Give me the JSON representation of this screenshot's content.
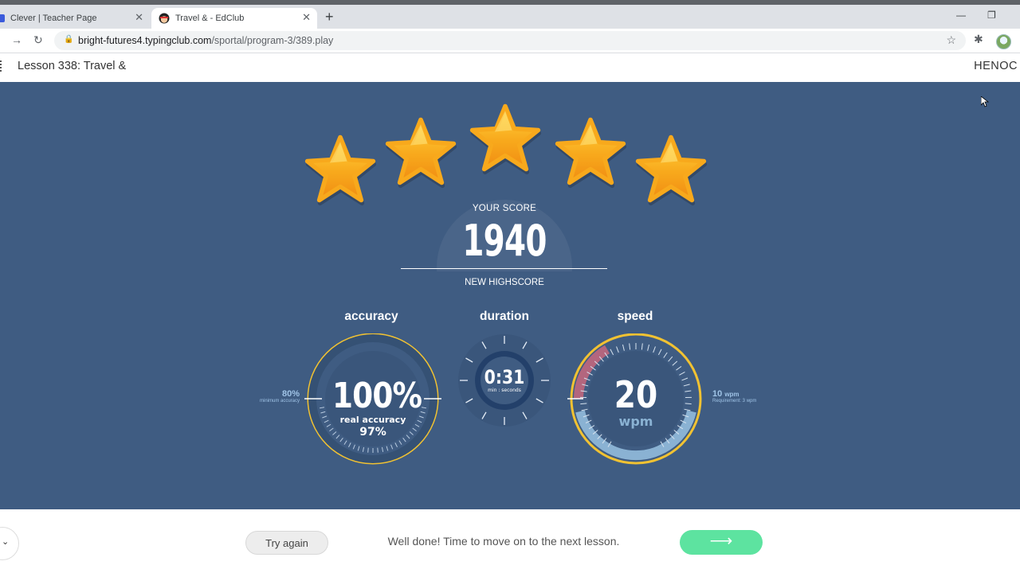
{
  "browser": {
    "tabs": [
      {
        "title": "Clever | Teacher Page",
        "active": false
      },
      {
        "title": "Travel & - EdClub",
        "active": true
      }
    ],
    "url_host": "bright-futures4.typingclub.com",
    "url_path": "/sportal/program-3/389.play"
  },
  "lesson": {
    "title": "Lesson 338: Travel &",
    "user": "HENOC"
  },
  "result": {
    "stars": 5,
    "score_label": "YOUR SCORE",
    "score": "1940",
    "highscore_label": "NEW HIGHSCORE"
  },
  "gauges": {
    "accuracy": {
      "title": "accuracy",
      "value": "100%",
      "real_label": "real accuracy",
      "real_value": "97%",
      "min_value": "80%",
      "min_label": "minimum accuracy"
    },
    "duration": {
      "title": "duration",
      "value": "0:31",
      "unit": "min : seconds"
    },
    "speed": {
      "title": "speed",
      "value": "20",
      "unit": "wpm",
      "req_value": "10",
      "req_unit": "wpm",
      "req_label": "Requirement: 3 wpm"
    }
  },
  "footer": {
    "try_again": "Try again",
    "message": "Well done! Time to move on to the next lesson.",
    "next_arrow": "⟶"
  },
  "colors": {
    "panel": "#3f5c82",
    "gauge_ring": "#f1c232",
    "star": "#f7a71c",
    "next_button": "#5de3a0"
  }
}
